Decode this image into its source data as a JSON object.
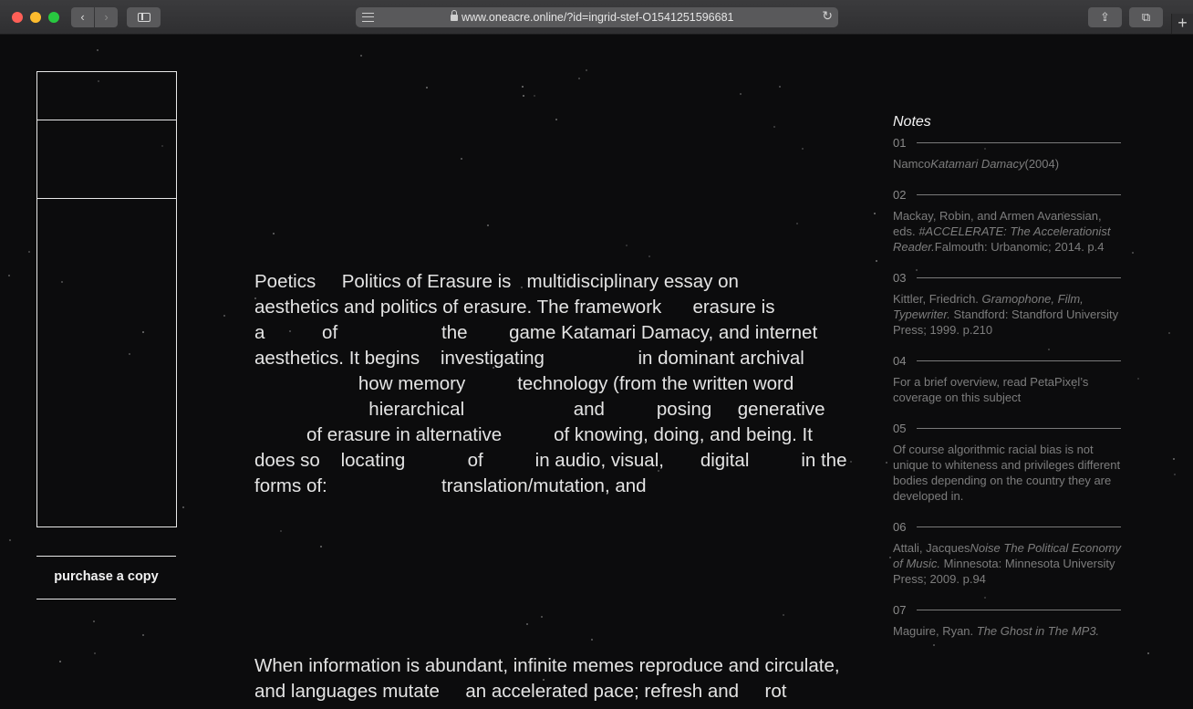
{
  "browser": {
    "url": "www.oneacre.online/?id=ingrid-stef-O1541251596681",
    "back_icon": "‹",
    "forward_icon": "›",
    "reload_icon": "↻",
    "share_icon": "⇪",
    "tabs_icon": "⧉",
    "new_tab_icon": "+"
  },
  "sidebar": {
    "purchase_label": "purchase a copy"
  },
  "essay": {
    "paragraph1": [
      "Poetics     Politics of Erasure is   multidisciplinary essay on",
      "aesthetics and politics of erasure. The framework      erasure is",
      "a           of                    the        game Katamari Damacy, and internet",
      "aesthetics. It begins    investigating                  in dominant archival",
      "                    how memory          technology (from the written word",
      "                      hierarchical                     and          posing     generative",
      "          of erasure in alternative          of knowing, doing, and being. It",
      "does so    locating            of          in audio, visual,       digital          in the",
      "forms of:                      translation/mutation, and"
    ],
    "paragraph2": [
      "When information is abundant, infinite memes reproduce and circulate,",
      "and languages mutate     an accelerated pace; refresh and     rot"
    ]
  },
  "notes": {
    "title": "Notes",
    "items": [
      {
        "num": "01",
        "parts": [
          [
            "",
            "Namco"
          ],
          [
            "i",
            "Katamari Damacy"
          ],
          [
            "",
            "(2004)"
          ]
        ]
      },
      {
        "num": "02",
        "parts": [
          [
            "",
            "Mackay, Robin, and Armen Avanessian, eds. "
          ],
          [
            "i",
            "#ACCELERATE: The Accelerationist Reader."
          ],
          [
            "",
            "Falmouth: Urbanomic; 2014. p.4"
          ]
        ]
      },
      {
        "num": "03",
        "parts": [
          [
            "",
            "Kittler, Friedrich. "
          ],
          [
            "i",
            "Gramophone, Film, Typewriter."
          ],
          [
            "",
            " Standford: Standford University Press; 1999. p.210"
          ]
        ]
      },
      {
        "num": "04",
        "parts": [
          [
            "",
            "For a brief overview, read PetaPixel’s coverage on this subject"
          ]
        ]
      },
      {
        "num": "05",
        "parts": [
          [
            "",
            "Of course algorithmic racial bias is not unique to whiteness and privileges different bodies depending on the country they are developed in."
          ]
        ]
      },
      {
        "num": "06",
        "parts": [
          [
            "",
            "Attali, Jacques"
          ],
          [
            "i",
            "Noise The Political Economy of Music."
          ],
          [
            "",
            " Minnesota: Minnesota University Press; 2009. p.94"
          ]
        ]
      },
      {
        "num": "07",
        "parts": [
          [
            "",
            "Maguire, Ryan. "
          ],
          [
            "i",
            "The Ghost in The MP3."
          ]
        ]
      }
    ]
  },
  "colors": {
    "background": "#0c0c0d",
    "text": "#e4e4e4",
    "note_text": "#7d7d7d"
  }
}
